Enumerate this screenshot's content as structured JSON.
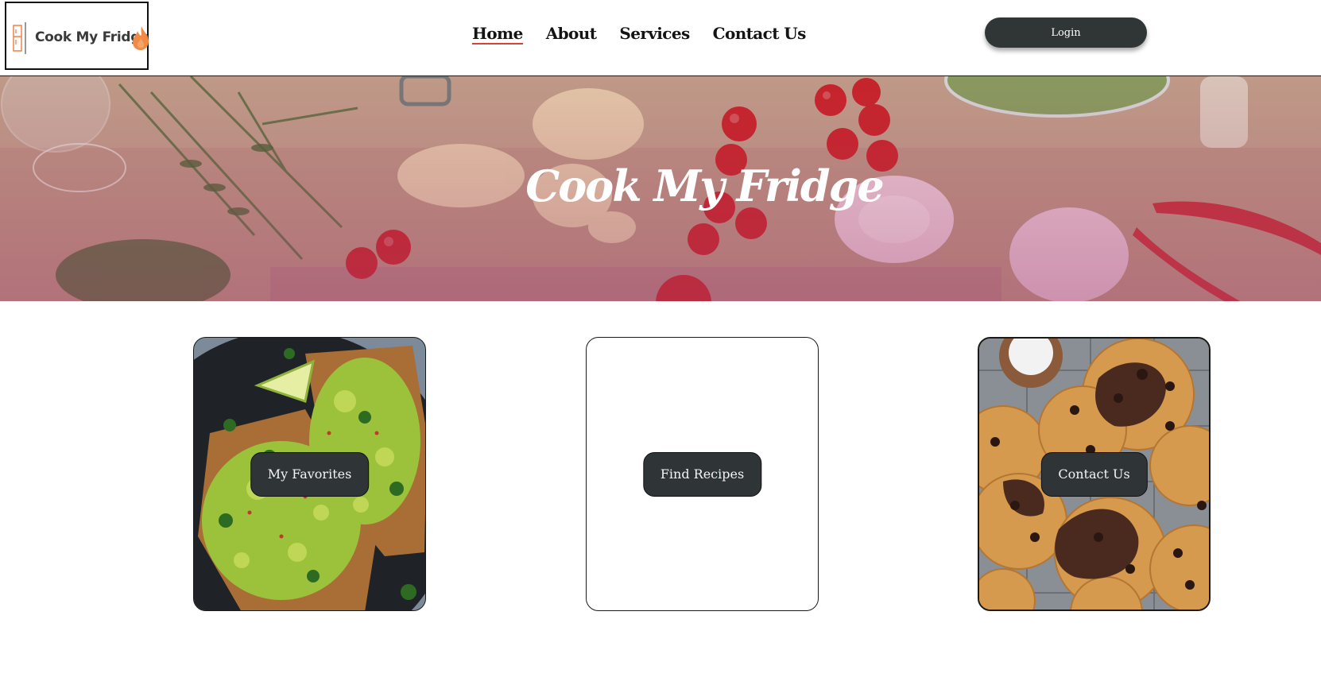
{
  "brand": {
    "logo_text": "Cook My Fridge"
  },
  "nav": {
    "items": [
      {
        "label": "Home",
        "active": true
      },
      {
        "label": "About",
        "active": false
      },
      {
        "label": "Services",
        "active": false
      },
      {
        "label": "Contact Us",
        "active": false
      }
    ]
  },
  "header": {
    "login_label": "Login"
  },
  "hero": {
    "title": "Cook My Fridge"
  },
  "cards": [
    {
      "button_label": "My Favorites",
      "image": "avocado-toast-photo"
    },
    {
      "button_label": "Find Recipes",
      "image": "none"
    },
    {
      "button_label": "Contact Us",
      "image": "cookies-photo"
    }
  ],
  "colors": {
    "button_dark": "#303536",
    "nav_underline": "#d9403a",
    "logo_accent": "#f07a3a"
  }
}
